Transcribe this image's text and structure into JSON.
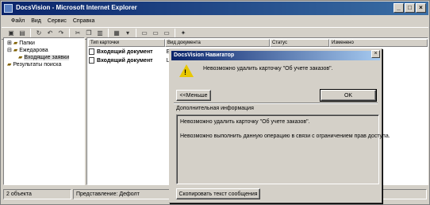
{
  "window": {
    "title": "DocsVision - Microsoft Internet Explorer",
    "controls": [
      "_",
      "□",
      "×"
    ]
  },
  "menu": [
    "Файл",
    "Вид",
    "Сервис",
    "Справка"
  ],
  "toolbar_icons": [
    "save-icon",
    "open-icon",
    "refresh-icon",
    "back-icon",
    "forward-icon",
    "cut-icon",
    "copy-icon",
    "paste-icon",
    "view-icon",
    "view-icon",
    "layout-icon",
    "layout-icon",
    "layout-icon",
    "help-icon"
  ],
  "tree": {
    "items": [
      {
        "label": "Папки",
        "expander": "⊞"
      },
      {
        "label": "Ежедарова",
        "expander": "⊟"
      },
      {
        "label": "Входящие заявки",
        "expander": ""
      },
      {
        "label": "Результаты поиска",
        "expander": ""
      }
    ]
  },
  "list": {
    "columns": [
      "Тип карточки",
      "Вид документа",
      "Статус",
      "Изменено"
    ],
    "rows": [
      {
        "name": "Входящий документ",
        "extra": "E"
      },
      {
        "name": "Входящий документ",
        "extra": "L"
      }
    ]
  },
  "status": {
    "objects": "2 объекта",
    "view": "Представление: Дефолт"
  },
  "dialog": {
    "title": "DocsVision Навигатор",
    "close": "×",
    "message": "Невозможно удалить карточку \"Об учете заказов\".",
    "less_button": "<<Меньше",
    "ok_button": "OK",
    "details_label": "Дополнительная информация",
    "details_line1": "Невозможно удалить карточку \"Об учете заказов\".",
    "details_line2": "Невозможно выполнить данную операцию в связи с ограничением прав доступа.",
    "copy_button": "Скопировать текст сообщения"
  },
  "colors": {
    "titlebar": "#0a246a",
    "face": "#d4d0c8",
    "warning": "#e8c800"
  }
}
